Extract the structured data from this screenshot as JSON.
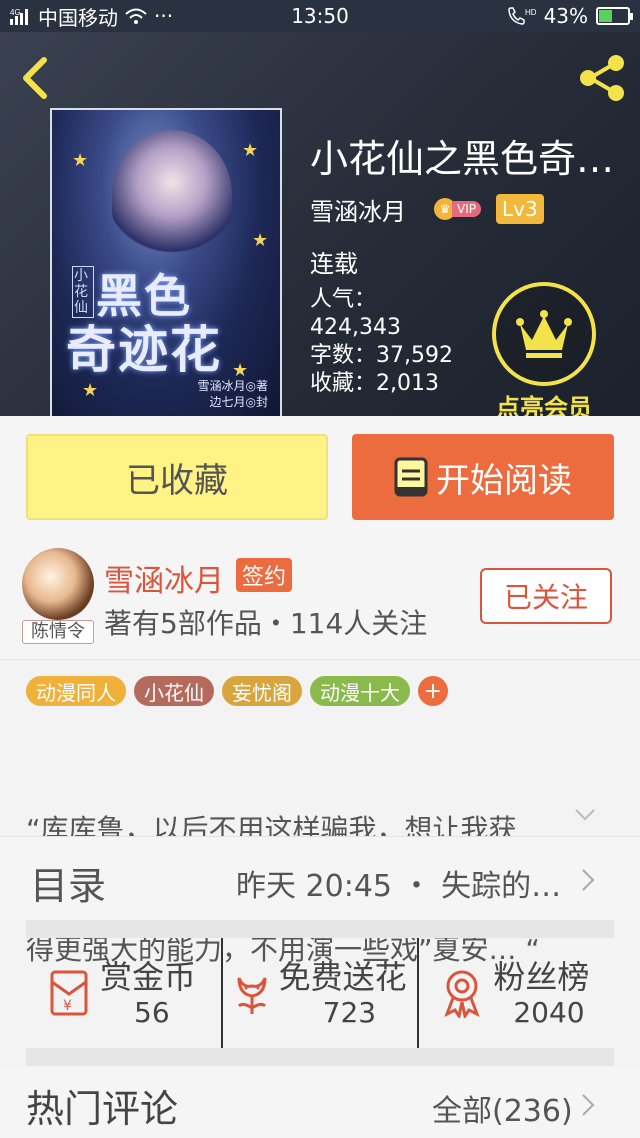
{
  "status_bar": {
    "carrier": "中国移动",
    "network": "4G",
    "dots": "···",
    "time": "13:50",
    "hd": "HD",
    "battery": "43%"
  },
  "book": {
    "title": "小花仙之黑色奇…",
    "author": "雪涵冰月",
    "vip_label": "VIP",
    "level": "Lv3",
    "status": "连载",
    "popularity_label": "人气：",
    "popularity_value": "424,343",
    "word_count": "字数：37,592",
    "favorites": "收藏：2,013",
    "cover": {
      "small_title": "小花仙",
      "title_line1": "黑色",
      "title_line2": "奇迹花",
      "author_line1": "雪涵冰月◎著",
      "author_line2": "边七月◎封"
    }
  },
  "member": {
    "label": "点亮会员"
  },
  "actions": {
    "favorited": "已收藏",
    "start_reading": "开始阅读"
  },
  "author_card": {
    "avatar_tag": "陈情令",
    "name": "雪涵冰月",
    "sign_badge": "签约",
    "meta": "著有5部作品・114人关注",
    "follow_label": "已关注"
  },
  "tags": [
    {
      "label": "动漫同人",
      "color": "#f0b13a"
    },
    {
      "label": "小花仙",
      "color": "#b56a5e"
    },
    {
      "label": "妄忧阁",
      "color": "#d8a53e"
    },
    {
      "label": "动漫十大",
      "color": "#8ab94c"
    }
  ],
  "tag_more": "+",
  "description": {
    "line1": "“库库鲁，以后不用这样骗我，想让我获",
    "line2": "得更强大的能力，不用演一些戏”夏安… “"
  },
  "toc": {
    "label": "目录",
    "latest": "昨天 20:45 ・ 失踪的…"
  },
  "rewards": [
    {
      "label": "赏金币",
      "value": "56"
    },
    {
      "label": "免费送花",
      "value": "723"
    },
    {
      "label": "粉丝榜",
      "value": "2040"
    }
  ],
  "comments": {
    "title": "热门评论",
    "all": "全部(236)"
  },
  "colors": {
    "accent": "#ec6b3f",
    "favorite_bg": "#fff386",
    "vip_gold": "#f4e24a",
    "author_red": "#d9553c"
  }
}
